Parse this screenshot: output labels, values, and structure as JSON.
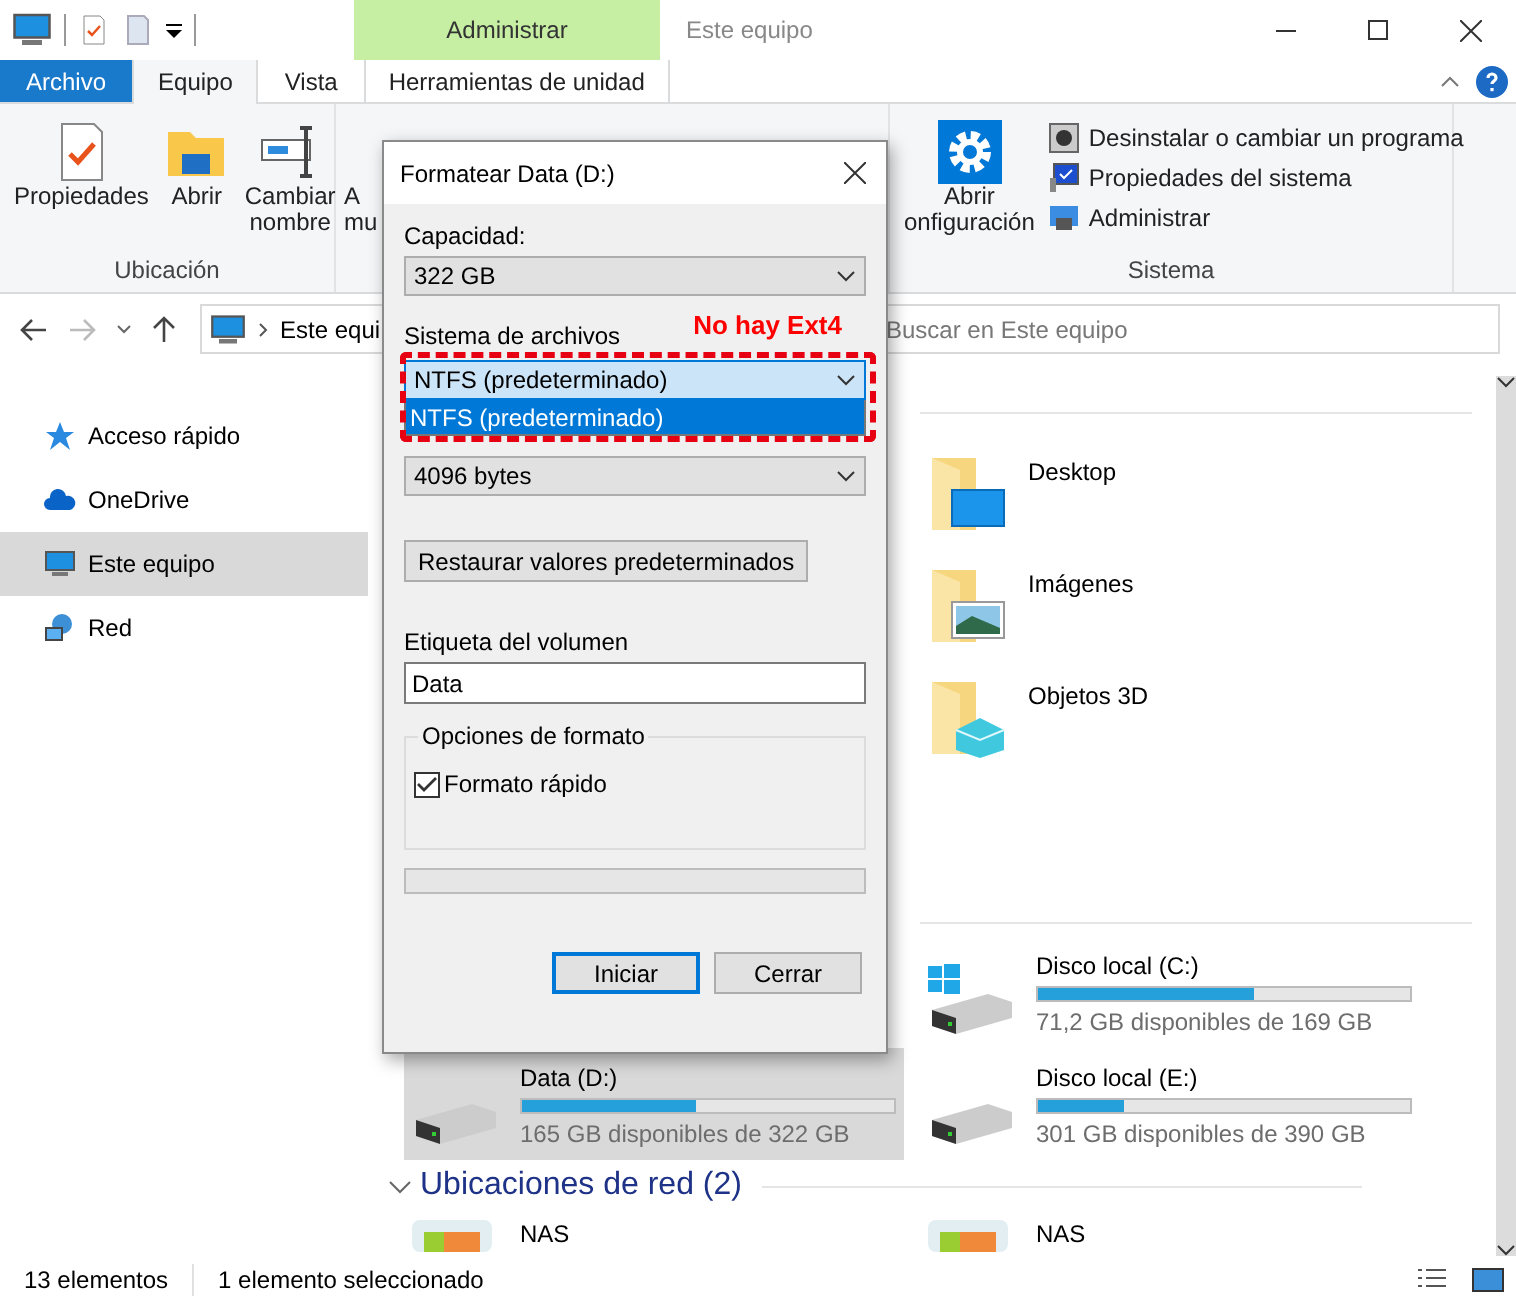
{
  "window": {
    "title": "Este equipo",
    "context_tab": "Administrar"
  },
  "tabs": [
    {
      "label": "Archivo",
      "kind": "file",
      "selected": false
    },
    {
      "label": "Equipo",
      "kind": "tab",
      "selected": true
    },
    {
      "label": "Vista",
      "kind": "tab",
      "selected": false
    },
    {
      "label": "Herramientas de unidad",
      "kind": "context",
      "selected": false
    }
  ],
  "ribbon": {
    "groups": [
      {
        "name": "Ubicación",
        "buttons": [
          {
            "lines": [
              "Propiedades"
            ]
          },
          {
            "lines": [
              "Abrir"
            ]
          },
          {
            "lines": [
              "Cambiar",
              "nombre"
            ]
          }
        ]
      },
      {
        "buttons": [
          {
            "lines": [
              "A",
              "mu"
            ]
          }
        ]
      },
      {
        "name": "Sistema",
        "buttons": [
          {
            "lines": [
              "Abrir",
              "onfiguración"
            ]
          }
        ],
        "small": [
          {
            "label": "Desinstalar o cambiar un programa"
          },
          {
            "label": "Propiedades del sistema"
          },
          {
            "label": "Administrar"
          }
        ]
      }
    ]
  },
  "address": {
    "crumb": "Este equi"
  },
  "search": {
    "placeholder": "Buscar en Este equipo"
  },
  "sidebar": {
    "items": [
      {
        "label": "Acceso rápido",
        "selected": false
      },
      {
        "label": "OneDrive",
        "selected": false
      },
      {
        "label": "Este equipo",
        "selected": true
      },
      {
        "label": "Red",
        "selected": false
      }
    ]
  },
  "folders": [
    {
      "name": "Desktop"
    },
    {
      "name": "Imágenes"
    },
    {
      "name": "Objetos 3D"
    }
  ],
  "drives": [
    {
      "name": "Disco local (C:)",
      "level": 0.58,
      "reading": "71,2 GB disponibles de 169 GB",
      "selected": false
    },
    {
      "name": "Data (D:)",
      "level": 0.47,
      "reading": "165 GB disponibles de 322 GB",
      "selected": true
    },
    {
      "name": "Disco local (E:)",
      "level": 0.23,
      "reading": "301 GB disponibles de 390 GB",
      "selected": false
    }
  ],
  "network": {
    "header": "Ubicaciones de red (2)",
    "expanded": true,
    "items": [
      {
        "name": "NAS"
      },
      {
        "name": "NAS"
      }
    ]
  },
  "status_bar": {
    "count": "13 elementos",
    "selection": "1 elemento seleccionado"
  },
  "dialog": {
    "title": "Formatear Data (D:)",
    "capacity": {
      "label": "Capacidad:",
      "value": "322 GB"
    },
    "filesystem": {
      "label": "Sistema de archivos",
      "value": "NTFS (predeterminado)",
      "expanded": true,
      "options": [
        {
          "label": "NTFS (predeterminado)",
          "selected": true
        }
      ]
    },
    "annotation": "No hay Ext4",
    "allocation": {
      "value": "4096 bytes"
    },
    "restore_button": "Restaurar valores predeterminados",
    "volume": {
      "label": "Etiqueta del volumen",
      "value": "Data"
    },
    "options": {
      "legend": "Opciones de formato",
      "quick": {
        "label": "Formato rápido",
        "checked": true
      }
    },
    "progress": {
      "level": 0
    },
    "buttons": [
      {
        "label": "Iniciar",
        "kind": "default"
      },
      {
        "label": "Cerrar",
        "kind": "normal"
      }
    ]
  }
}
